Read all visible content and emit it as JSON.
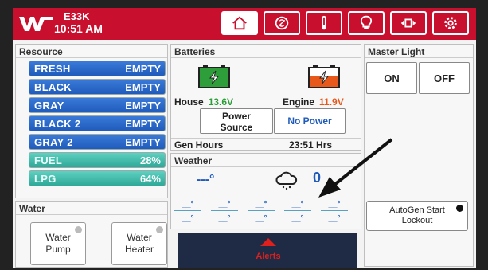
{
  "header": {
    "model": "E33K",
    "time": "10:51 AM",
    "tabs": [
      {
        "name": "home",
        "icon": "home-icon",
        "active": true
      },
      {
        "name": "climate",
        "icon": "fan-icon"
      },
      {
        "name": "temperature",
        "icon": "thermometer-icon"
      },
      {
        "name": "lights",
        "icon": "lightbulb-icon"
      },
      {
        "name": "slides",
        "icon": "slide-icon"
      },
      {
        "name": "settings",
        "icon": "gear-icon"
      }
    ]
  },
  "resource": {
    "title": "Resource",
    "tanks": [
      {
        "name": "FRESH",
        "value": "EMPTY"
      },
      {
        "name": "BLACK",
        "value": "EMPTY"
      },
      {
        "name": "GRAY",
        "value": "EMPTY"
      },
      {
        "name": "BLACK 2",
        "value": "EMPTY"
      },
      {
        "name": "GRAY 2",
        "value": "EMPTY"
      },
      {
        "name": "FUEL",
        "value": "28%"
      },
      {
        "name": "LPG",
        "value": "64%"
      }
    ]
  },
  "water": {
    "title": "Water",
    "pump": "Water\nPump",
    "pump_line1": "Water",
    "pump_line2": "Pump",
    "heater_line1": "Water",
    "heater_line2": "Heater"
  },
  "batteries": {
    "title": "Batteries",
    "house_label": "House",
    "house_voltage": "13.6V",
    "engine_label": "Engine",
    "engine_voltage": "11.9V",
    "power_source_line1": "Power",
    "power_source_line2": "Source",
    "power_source_value": "No Power",
    "gen_hours_label": "Gen Hours",
    "gen_hours_value": "23:51 Hrs"
  },
  "weather": {
    "title": "Weather",
    "current_temp": "---°",
    "partial_value": "0",
    "forecast": [
      "__°",
      "__°",
      "__°",
      "__°",
      "__°"
    ],
    "forecast_low": [
      "__°",
      "__°",
      "__°",
      "__°",
      "__°"
    ]
  },
  "alerts": {
    "label": "Alerts"
  },
  "master_light": {
    "title": "Master Light",
    "on_label": "ON",
    "off_label": "OFF",
    "autogen_line1": "AutoGen Start",
    "autogen_line2": "Lockout"
  },
  "colors": {
    "brand_red": "#c8102e",
    "tank_blue": "#1f5bbb",
    "tank_teal": "#2ea898",
    "house_green": "#2e9e3a",
    "engine_orange": "#e8581a"
  }
}
